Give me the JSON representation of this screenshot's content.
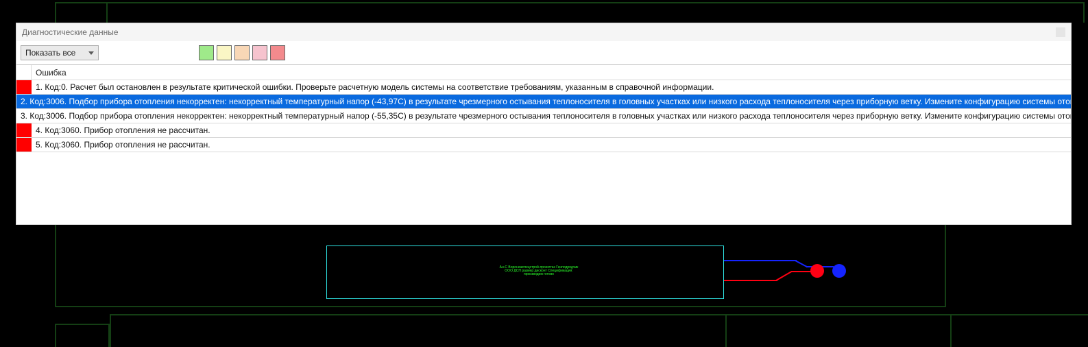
{
  "panel": {
    "title": "Диагностические данные",
    "dropdown_label": "Показать все",
    "header_error": "Ошибка",
    "swatches": [
      "#9fea8a",
      "#faf6c5",
      "#f8d7b6",
      "#f6c3ce",
      "#f38a8d"
    ]
  },
  "rows": [
    {
      "severity_color": "#ff0000",
      "selected": false,
      "text": "1. Код:0. Расчет был остановлен в результате критической ошибки. Проверьте расчетную модель системы на соответствие требованиям, указанным в справочной информации."
    },
    {
      "severity_color": "#ff0000",
      "selected": true,
      "text": "2. Код:3006. Подбор прибора отопления некорректен: некорректный температурный напор (-43,97C) в результате чрезмерного остывания теплоносителя в головных участках или низкого расхода теплоносителя через приборную ветку. Измените конфигурацию системы отопления."
    },
    {
      "severity_color": "#ff0000",
      "selected": false,
      "text": "3. Код:3006. Подбор прибора отопления некорректен: некорректный температурный напор (-55,35C) в результате чрезмерного остывания теплоносителя в головных участках или низкого расхода теплоносителя через приборную ветку. Измените конфигурацию системы отопления."
    },
    {
      "severity_color": "#ff0000",
      "selected": false,
      "text": "4. Код:3060. Прибор отопления не рассчитан."
    },
    {
      "severity_color": "#ff0000",
      "selected": false,
      "text": "5. Код:3060. Прибор отопления не рассчитан."
    }
  ],
  "cad": {
    "small_text": "Ан-С\nВоронежспецстрой-проектгаз\nГенподрядчик ООО ДСП размер дисконт\nСпецификация: производим готово"
  }
}
